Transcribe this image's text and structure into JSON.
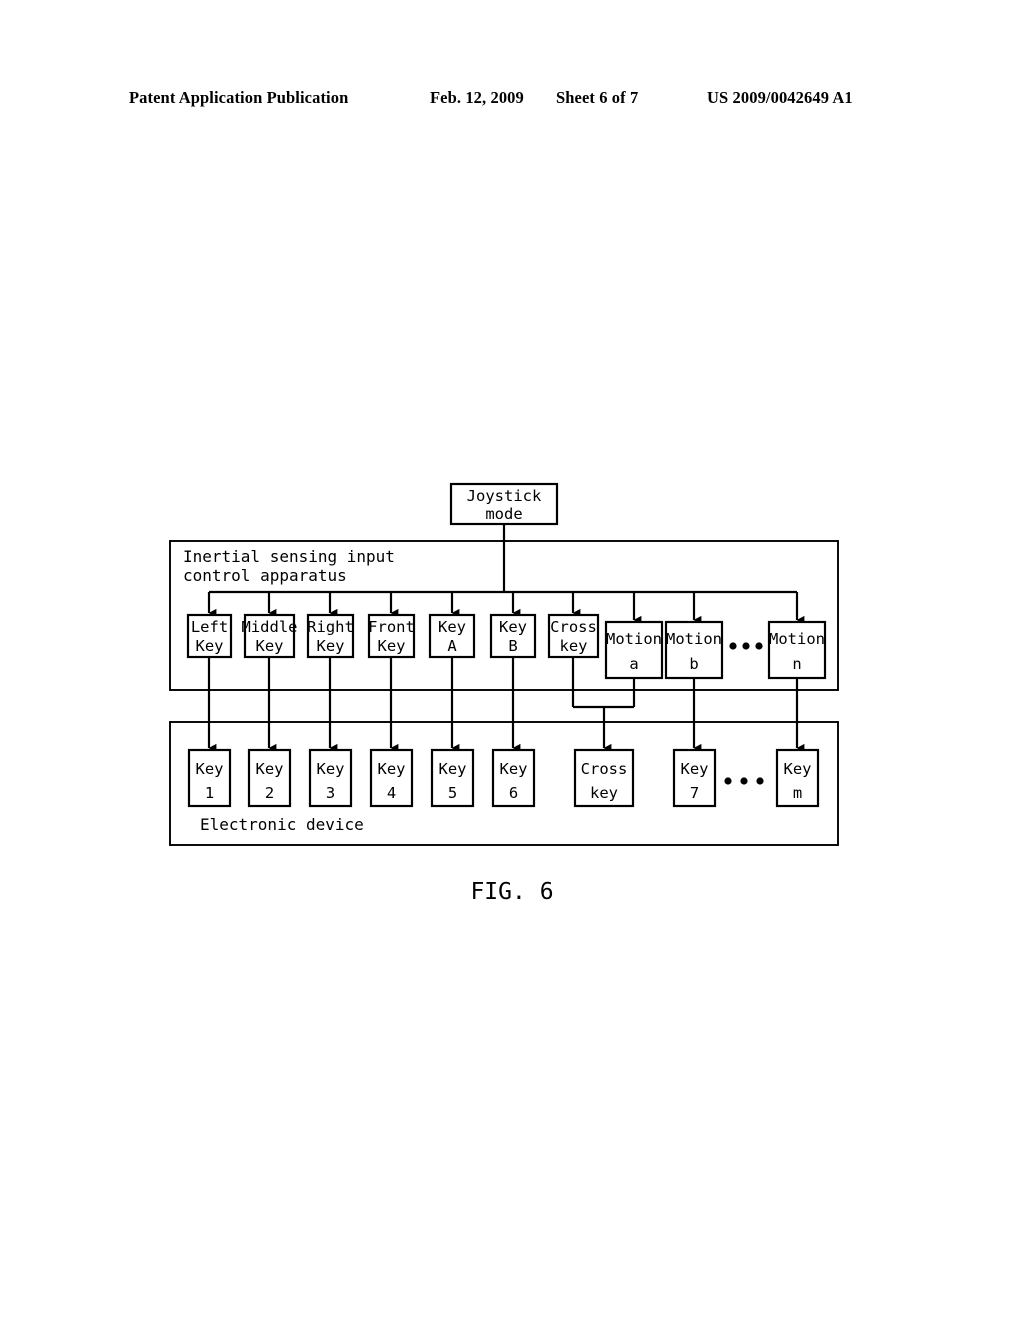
{
  "header": {
    "publication": "Patent Application Publication",
    "date": "Feb. 12, 2009",
    "sheet": "Sheet 6 of 7",
    "number": "US 2009/0042649 A1"
  },
  "figure": {
    "caption": "FIG. 6",
    "mode_box": {
      "line1": "Joystick",
      "line2": "mode"
    },
    "apparatus": {
      "label_line1": "Inertial sensing input",
      "label_line2": "control apparatus",
      "inputs": [
        {
          "line1": "Left",
          "line2": "Key"
        },
        {
          "line1": "Middle",
          "line2": "Key"
        },
        {
          "line1": "Right",
          "line2": "Key"
        },
        {
          "line1": "Front",
          "line2": "Key"
        },
        {
          "line1": "Key",
          "line2": "A"
        },
        {
          "line1": "Key",
          "line2": "B"
        },
        {
          "line1": "Cross",
          "line2": "key"
        }
      ],
      "motions": [
        {
          "line1": "Motion",
          "line2": "a"
        },
        {
          "line1": "Motion",
          "line2": "b"
        },
        {
          "line1": "Motion",
          "line2": "n"
        }
      ],
      "motion_ellipsis": "..."
    },
    "device": {
      "label": "Electronic device",
      "outputs": [
        {
          "line1": "Key",
          "line2": "1"
        },
        {
          "line1": "Key",
          "line2": "2"
        },
        {
          "line1": "Key",
          "line2": "3"
        },
        {
          "line1": "Key",
          "line2": "4"
        },
        {
          "line1": "Key",
          "line2": "5"
        },
        {
          "line1": "Key",
          "line2": "6"
        },
        {
          "line1": "Cross",
          "line2": "key"
        },
        {
          "line1": "Key",
          "line2": "7"
        },
        {
          "line1": "Key",
          "line2": "m"
        }
      ],
      "output_ellipsis": "..."
    }
  },
  "colors": {
    "ink": "#000000",
    "paper": "#ffffff"
  }
}
